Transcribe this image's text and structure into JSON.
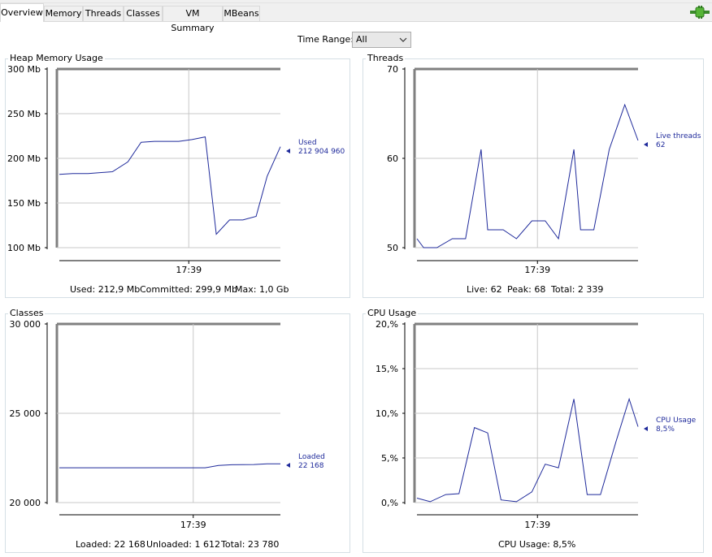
{
  "tabs": [
    {
      "label": "Overview",
      "active": true
    },
    {
      "label": "Memory"
    },
    {
      "label": "Threads"
    },
    {
      "label": "Classes"
    },
    {
      "label": "VM Summary"
    },
    {
      "label": "MBeans"
    }
  ],
  "toolbar": {
    "plugin_icon": "plug-connection-icon"
  },
  "time_range": {
    "label": "Time Range:",
    "value": "All"
  },
  "colors": {
    "series": "#1f2a9b",
    "grid": "#c8c8c8",
    "frame": "#808080",
    "panel_border": "#d5dfe5"
  },
  "panels": {
    "heap": {
      "title": "Heap Memory Usage",
      "footer": {
        "used": "Used: 212,9 Mb",
        "committed": "Committed: 299,9 Mb",
        "max": "Max: 1,0 Gb"
      },
      "legend": {
        "name": "Used",
        "value": "212 904 960"
      }
    },
    "threads": {
      "title": "Threads",
      "footer": {
        "live": "Live: 62",
        "peak": "Peak: 68",
        "total": "Total: 2 339"
      },
      "legend": {
        "name": "Live threads",
        "value": "62"
      }
    },
    "classes": {
      "title": "Classes",
      "footer": {
        "loaded": "Loaded: 22 168",
        "unloaded": "Unloaded: 1 612",
        "total": "Total: 23 780"
      },
      "legend": {
        "name": "Loaded",
        "value": "22 168"
      }
    },
    "cpu": {
      "title": "CPU Usage",
      "footer": {
        "usage": "CPU Usage: 8,5%"
      },
      "legend": {
        "name": "CPU Usage",
        "value": "8,5%"
      }
    }
  },
  "chart_data": [
    {
      "id": "heap",
      "type": "line",
      "yticks": [
        "300 Mb",
        "250 Mb",
        "200 Mb",
        "150 Mb",
        "100 Mb"
      ],
      "ytick_values": [
        300,
        250,
        200,
        150,
        100
      ],
      "xticks": [
        "17:39"
      ],
      "xtick_positions": [
        0.59
      ],
      "ylim": [
        100,
        300
      ],
      "xlim": [
        0,
        1
      ],
      "series": [
        {
          "name": "Used",
          "points": [
            [
              0,
              182
            ],
            [
              0.06,
              183
            ],
            [
              0.13,
              183
            ],
            [
              0.24,
              185
            ],
            [
              0.31,
              196
            ],
            [
              0.37,
              218
            ],
            [
              0.43,
              219
            ],
            [
              0.54,
              219
            ],
            [
              0.6,
              221
            ],
            [
              0.66,
              224
            ],
            [
              0.71,
              115
            ],
            [
              0.77,
              131
            ],
            [
              0.83,
              131
            ],
            [
              0.89,
              135
            ],
            [
              0.94,
              180
            ],
            [
              1.0,
              213
            ]
          ]
        }
      ]
    },
    {
      "id": "threads",
      "type": "line",
      "yticks": [
        "70",
        "60",
        "50"
      ],
      "ytick_values": [
        70,
        60,
        50
      ],
      "xticks": [
        "17:39"
      ],
      "xtick_positions": [
        0.55
      ],
      "ylim": [
        50,
        70
      ],
      "xlim": [
        0,
        1
      ],
      "series": [
        {
          "name": "Live threads",
          "points": [
            [
              0,
              51
            ],
            [
              0.03,
              50
            ],
            [
              0.09,
              50
            ],
            [
              0.16,
              51
            ],
            [
              0.22,
              51
            ],
            [
              0.29,
              61
            ],
            [
              0.32,
              52
            ],
            [
              0.39,
              52
            ],
            [
              0.45,
              51
            ],
            [
              0.52,
              53
            ],
            [
              0.58,
              53
            ],
            [
              0.64,
              51
            ],
            [
              0.71,
              61
            ],
            [
              0.74,
              52
            ],
            [
              0.8,
              52
            ],
            [
              0.87,
              61
            ],
            [
              0.94,
              66
            ],
            [
              1.0,
              62
            ]
          ]
        }
      ]
    },
    {
      "id": "classes",
      "type": "line",
      "yticks": [
        "30 000",
        "25 000",
        "20 000"
      ],
      "ytick_values": [
        30000,
        25000,
        20000
      ],
      "xticks": [
        "17:39"
      ],
      "xtick_positions": [
        0.61
      ],
      "ylim": [
        20000,
        30000
      ],
      "xlim": [
        0,
        1
      ],
      "series": [
        {
          "name": "Loaded",
          "points": [
            [
              0,
              21950
            ],
            [
              0.55,
              21950
            ],
            [
              0.66,
              21950
            ],
            [
              0.72,
              22080
            ],
            [
              0.78,
              22120
            ],
            [
              0.88,
              22130
            ],
            [
              0.94,
              22168
            ],
            [
              1.0,
              22168
            ]
          ]
        }
      ]
    },
    {
      "id": "cpu",
      "type": "line",
      "yticks": [
        "20,%",
        "15,%",
        "10,%",
        "5,%",
        "0,%"
      ],
      "ytick_values": [
        20,
        15,
        10,
        5,
        0
      ],
      "xticks": [
        "17:39"
      ],
      "xtick_positions": [
        0.55
      ],
      "ylim": [
        0,
        20
      ],
      "xlim": [
        0,
        1
      ],
      "series": [
        {
          "name": "CPU Usage",
          "points": [
            [
              0,
              0.5
            ],
            [
              0.06,
              0.1
            ],
            [
              0.13,
              0.9
            ],
            [
              0.19,
              1.0
            ],
            [
              0.26,
              8.4
            ],
            [
              0.32,
              7.8
            ],
            [
              0.38,
              0.3
            ],
            [
              0.45,
              0.1
            ],
            [
              0.52,
              1.2
            ],
            [
              0.58,
              4.3
            ],
            [
              0.64,
              3.9
            ],
            [
              0.71,
              11.6
            ],
            [
              0.77,
              0.9
            ],
            [
              0.83,
              0.9
            ],
            [
              0.9,
              6.8
            ],
            [
              0.96,
              11.6
            ],
            [
              1.0,
              8.5
            ]
          ]
        }
      ]
    }
  ]
}
